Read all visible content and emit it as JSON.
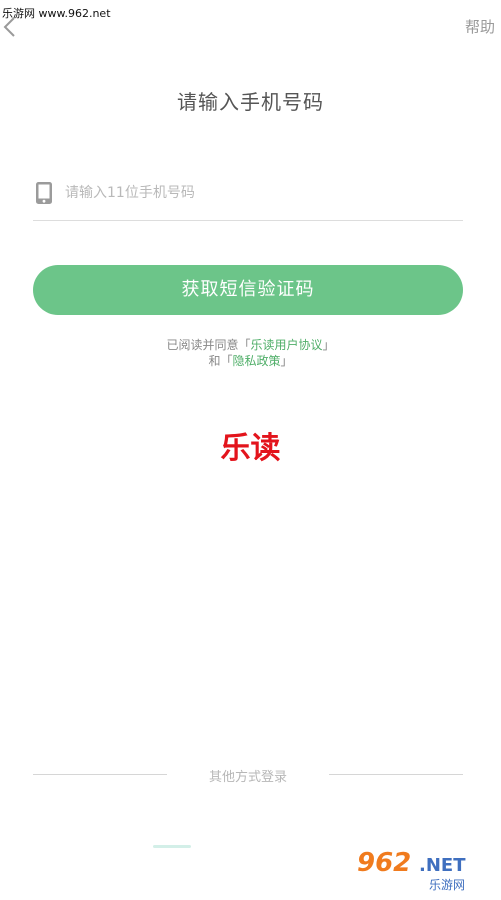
{
  "watermark_top": "乐游网 www.962.net",
  "header": {
    "help_label": "帮助"
  },
  "title": "请输入手机号码",
  "phone_input": {
    "placeholder": "请输入11位手机号码",
    "value": ""
  },
  "sms_button_label": "获取短信验证码",
  "agreement": {
    "prefix": "已阅读并同意",
    "open_bracket": "「",
    "user_agreement": "乐读用户协议",
    "close_bracket": "」",
    "connector": "和",
    "privacy_policy": "隐私政策"
  },
  "brand_logo": "乐读",
  "other_login_label": "其他方式登录",
  "watermark_bottom": {
    "number": "962",
    "suffix": ".NET",
    "name": "乐游网"
  },
  "colors": {
    "accent_green": "#6cc589",
    "link_green": "#4fae68",
    "logo_red": "#e3141c"
  }
}
